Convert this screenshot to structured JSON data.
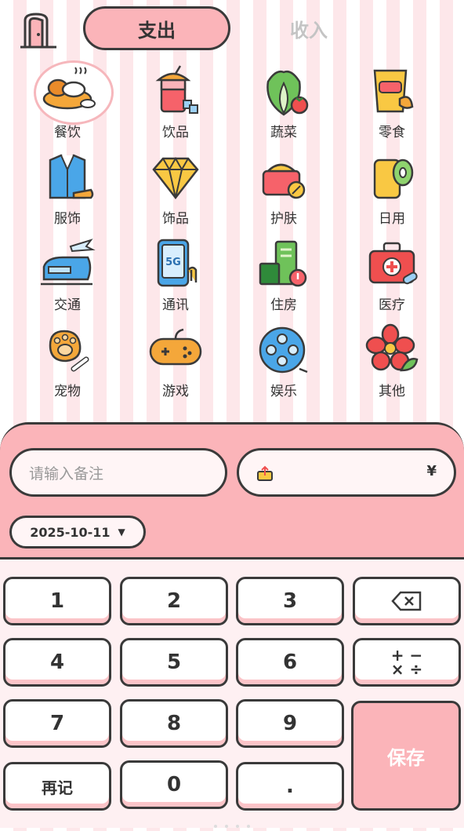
{
  "header": {
    "tabs": [
      {
        "label": "支出",
        "active": true
      },
      {
        "label": "收入",
        "active": false
      }
    ]
  },
  "categories": [
    {
      "label": "餐饮",
      "icon": "meal-icon",
      "selected": true
    },
    {
      "label": "饮品",
      "icon": "drink-icon"
    },
    {
      "label": "蔬菜",
      "icon": "vegetable-icon"
    },
    {
      "label": "零食",
      "icon": "snack-icon"
    },
    {
      "label": "服饰",
      "icon": "clothing-icon"
    },
    {
      "label": "饰品",
      "icon": "jewelry-icon"
    },
    {
      "label": "护肤",
      "icon": "skincare-icon"
    },
    {
      "label": "日用",
      "icon": "daily-use-icon"
    },
    {
      "label": "交通",
      "icon": "train-icon"
    },
    {
      "label": "通讯",
      "icon": "phone-icon"
    },
    {
      "label": "住房",
      "icon": "housing-icon"
    },
    {
      "label": "医疗",
      "icon": "medical-kit-icon"
    },
    {
      "label": "宠物",
      "icon": "pet-paw-icon"
    },
    {
      "label": "游戏",
      "icon": "gamepad-icon"
    },
    {
      "label": "娱乐",
      "icon": "film-reel-icon"
    },
    {
      "label": "其他",
      "icon": "flower-icon"
    }
  ],
  "form": {
    "note_placeholder": "请输入备注",
    "currency_symbol": "¥",
    "date": "2025-10-11"
  },
  "keypad": {
    "keys": [
      "1",
      "2",
      "3",
      "4",
      "5",
      "6",
      "7",
      "8",
      "9",
      "0",
      "."
    ],
    "again_label": "再记",
    "save_label": "保存",
    "operators_label": "+ −\n× ÷"
  },
  "colors": {
    "accent": "#fbb4b9",
    "outline": "#3a3a3a",
    "stripe": "#fde7ea"
  }
}
